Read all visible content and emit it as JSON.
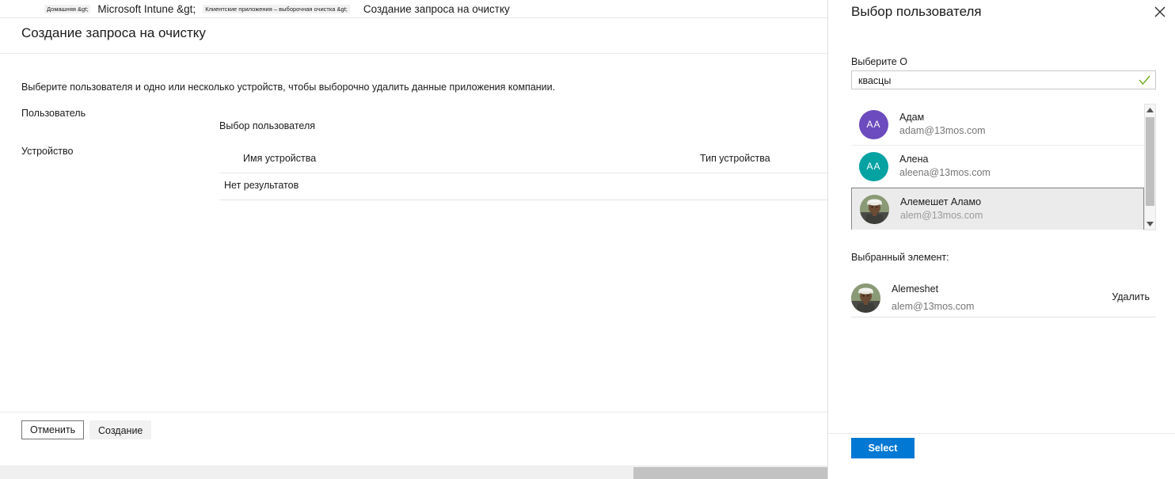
{
  "breadcrumb": {
    "items": [
      {
        "label": "Домашняя &gt;",
        "size": "tiny"
      },
      {
        "label": "Microsoft Intune &gt;",
        "size": "big"
      },
      {
        "label": "Клиентские приложения – выборочная очистка &gt;",
        "size": "mid"
      },
      {
        "label": "Создание запроса на очистку",
        "size": "cur"
      }
    ]
  },
  "blade": {
    "title": "Создание запроса на очистку",
    "description": "Выберите пользователя и одно или несколько устройств, чтобы выборочно удалить данные приложения компании.",
    "user_label": "Пользователь",
    "user_picker_value": "Выбор пользователя",
    "device_label": "Устройство",
    "table": {
      "columns": [
        "Имя устройства",
        "Тип устройства"
      ],
      "empty_text": "Нет результатов"
    },
    "actions": {
      "cancel": "Отменить",
      "create": "Создание"
    }
  },
  "panel": {
    "title": "Выбор пользователя",
    "close_icon": "close-icon",
    "search_label": "Выберите О",
    "search_value": "квасцы",
    "search_placeholder": "",
    "validation_icon": "checkmark-icon",
    "validation_color": "#5ba700",
    "results": [
      {
        "name": "Адам",
        "email": "adam@13mos.com",
        "initials": "AA",
        "avatar_type": "initials",
        "avatar_color": "#6c4bbe",
        "selected": false
      },
      {
        "name": "Алена",
        "email": "aleena@13mos.com",
        "initials": "AA",
        "avatar_type": "initials",
        "avatar_color": "#05a2a2",
        "selected": false
      },
      {
        "name": "Алемешет Аламо",
        "email": "alem@13mos.com",
        "initials": "",
        "avatar_type": "photo",
        "avatar_color": "#7d8e6c",
        "selected": true
      }
    ],
    "selected_section": {
      "label": "Выбранный элемент:",
      "name": "Alemeshet",
      "email": "alem@13mos.com",
      "remove_label": "Удалить",
      "avatar_type": "photo"
    },
    "footer": {
      "select_label": "Select",
      "select_color": "#0078d4"
    }
  }
}
